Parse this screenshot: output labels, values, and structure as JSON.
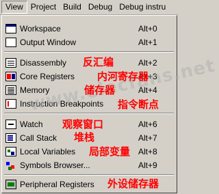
{
  "menubar": {
    "items": [
      "View",
      "Project",
      "Build",
      "Debug",
      "Debug instru"
    ]
  },
  "view_menu": {
    "items": [
      {
        "label": "Workspace",
        "accel": "Alt+0",
        "icon": "workspace-icon"
      },
      {
        "label": "Output Window",
        "accel": "Alt+1",
        "icon": "output-window-icon"
      },
      {
        "label": "Disassembly",
        "accel": "Alt+2",
        "icon": "disassembly-icon"
      },
      {
        "label": "Core Registers",
        "accel": "Alt+3",
        "icon": "core-registers-icon"
      },
      {
        "label": "Memory",
        "accel": "Alt+4",
        "icon": "memory-icon"
      },
      {
        "label": "Instruction Breakpoints",
        "accel": "",
        "icon": "breakpoints-icon"
      },
      {
        "label": "Watch",
        "accel": "Alt+6",
        "icon": "watch-icon"
      },
      {
        "label": "Call Stack",
        "accel": "Alt+7",
        "icon": "call-stack-icon"
      },
      {
        "label": "Local Variables",
        "accel": "Alt+8",
        "icon": "local-variables-icon"
      },
      {
        "label": "Symbols Browser...",
        "accel": "Alt+9",
        "icon": "symbols-browser-icon"
      },
      {
        "label": "Peripheral Registers",
        "accel": "",
        "icon": "peripheral-registers-icon"
      }
    ]
  },
  "annotations": {
    "disassembly": "反汇编",
    "core_registers": "内河寄存器",
    "memory": "储存器",
    "breakpoints": "指令断点",
    "watch": "观察窗口",
    "call_stack": "堆栈",
    "local_variables": "局部变量",
    "peripheral_registers": "外设储存器"
  },
  "watermark": "www.elecfans.net",
  "colors": {
    "menu_bg": "#d4d0c8",
    "annotation": "#ff0000"
  }
}
